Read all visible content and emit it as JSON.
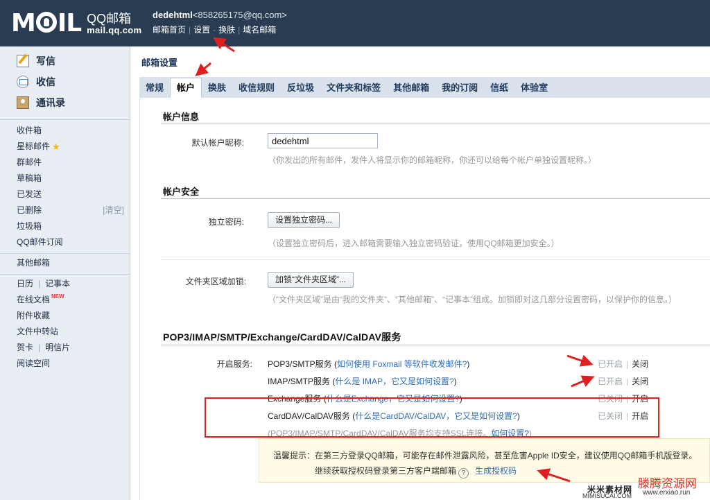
{
  "header": {
    "logo": {
      "text": "MAIL",
      "brand": "QQ邮箱",
      "domain": "mail.qq.com"
    },
    "user_name": "dedehtml",
    "user_email": "<858265175@qq.com>",
    "links": [
      "邮箱首页",
      "设置",
      "换肤",
      "域名邮箱"
    ],
    "link_seps": [
      "|",
      "-",
      "|"
    ]
  },
  "sidebar": {
    "main_nav": [
      {
        "label": "写信",
        "icon": "write-icon"
      },
      {
        "label": "收信",
        "icon": "inbox-icon"
      },
      {
        "label": "通讯录",
        "icon": "contacts-icon"
      }
    ],
    "folders": [
      {
        "label": "收件箱"
      },
      {
        "label": "星标邮件",
        "star": "★"
      },
      {
        "label": "群邮件"
      },
      {
        "label": "草稿箱"
      },
      {
        "label": "已发送"
      },
      {
        "label": "已删除",
        "extra": "[清空]"
      },
      {
        "label": "垃圾箱"
      },
      {
        "label": "QQ邮件订阅"
      }
    ],
    "other_mail": "其他邮箱",
    "apps": {
      "calendar": "日历",
      "notes": "记事本",
      "online_docs": "在线文档",
      "new_badge": "NEW",
      "attachments": "附件收藏",
      "file_transfer": "文件中转站",
      "greeting_card": "贺卡",
      "postcard": "明信片",
      "reading_space": "阅读空间",
      "sep": "|"
    }
  },
  "content": {
    "page_title": "邮箱设置",
    "tabs": [
      "常规",
      "帐户",
      "换肤",
      "收信规则",
      "反垃圾",
      "文件夹和标签",
      "其他邮箱",
      "我的订阅",
      "信纸",
      "体验室"
    ],
    "active_tab": 1,
    "account_info": {
      "title": "帐户信息",
      "nickname_label": "默认帐户昵称:",
      "nickname_value": "dedehtml",
      "nickname_hint": "（你发出的所有邮件，发件人将显示你的邮箱昵称，你还可以给每个帐户单独设置昵称。）"
    },
    "account_security": {
      "title": "帐户安全",
      "password_label": "独立密码:",
      "password_button": "设置独立密码...",
      "password_hint": "（设置独立密码后，进入邮箱需要输入独立密码验证，使用QQ邮箱更加安全。）",
      "folder_lock_label": "文件夹区域加锁:",
      "folder_lock_button": "加锁“文件夹区域”...",
      "folder_lock_hint": "（“文件夹区域”是由“我的文件夹”、“其他邮箱”、“记事本”组成。加锁即对这几部分设置密码，以保护你的信息。）"
    },
    "services": {
      "title": "POP3/IMAP/SMTP/Exchange/CardDAV/CalDAV服务",
      "open_label": "开启服务:",
      "items": [
        {
          "name": "POP3/SMTP服务",
          "paren_open": " (",
          "help": "如何使用 Foxmail 等软件收发邮件?",
          "paren_close": ")",
          "status": "已开启",
          "action": "关闭"
        },
        {
          "name": "IMAP/SMTP服务",
          "paren_open": " (",
          "help": "什么是 IMAP，它又是如何设置?",
          "paren_close": ")",
          "status": "已开启",
          "action": "关闭"
        },
        {
          "name": "Exchange服务",
          "paren_open": " (",
          "help": "什么是Exchange，它又是如何设置?",
          "paren_close": ")",
          "status": "已关闭",
          "action": "开启"
        },
        {
          "name": "CardDAV/CalDAV服务",
          "paren_open": " (",
          "help": "什么是CardDAV/CalDAV，它又是如何设置?",
          "paren_close": ")",
          "status": "已关闭",
          "action": "开启"
        }
      ],
      "status_sep": "|",
      "ssl_note": "(POP3/IMAP/SMTP/CardDAV/CalDAV服务均支持SSL连接。",
      "ssl_link": "如何设置?",
      "ssl_close": ")"
    },
    "tip": {
      "line1": "温馨提示：在第三方登录QQ邮箱，可能存在邮件泄露风险，甚至危害Apple ID安全，建议使用QQ邮箱手机版登录。",
      "line2": "继续获取授权码登录第三方客户端邮箱",
      "help_icon": "?",
      "link": "生成授权码"
    }
  },
  "watermarks": {
    "left": "米米素材网",
    "right": "滕腾资源网",
    "domain": "www.erxiao.run",
    "bottom": "MIMISUCAI.COM"
  },
  "colors": {
    "header_bg": "#293c52",
    "sidebar_bg": "#e9eef4",
    "link": "#2f6cb3",
    "highlight": "#e02020"
  }
}
